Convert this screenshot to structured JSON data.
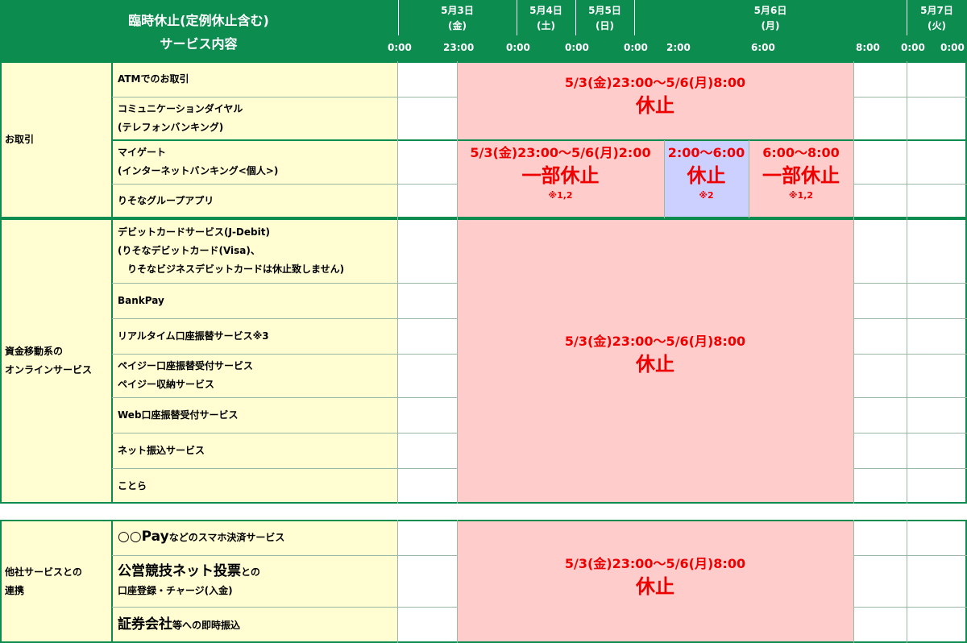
{
  "header": {
    "title_line1": "臨時休止(定例休止含む)",
    "title_line2": "サービス内容",
    "dates": [
      {
        "line1": "5月3日",
        "line2": "(金)"
      },
      {
        "line1": "5月4日",
        "line2": "(土)"
      },
      {
        "line1": "5月5日",
        "line2": "(日)"
      },
      {
        "line1": "5月6日",
        "line2": "(月)"
      },
      {
        "line1": "5月7日",
        "line2": "(火)"
      }
    ],
    "times": [
      "0:00",
      "23:00",
      "0:00",
      "0:00",
      "0:00",
      "2:00",
      "6:00",
      "8:00",
      "0:00",
      "0:00"
    ]
  },
  "section1": {
    "category": "お取引",
    "services": [
      {
        "line1": "ATMでのお取引"
      },
      {
        "line1": "コミュニケーションダイヤル",
        "line2": "(テレフォンバンキング)"
      },
      {
        "line1": "マイゲート",
        "line2": "(インターネットバンキング<個人>)"
      },
      {
        "line1": "りそなグループアプリ"
      }
    ],
    "outage_a": {
      "period": "5/3(金)23:00～5/6(月)8:00",
      "label": "休止"
    },
    "outage_b1": {
      "period": "5/3(金)23:00～5/6(月)2:00",
      "label": "一部休止",
      "note": "※1,2"
    },
    "outage_b2": {
      "period": "2:00～6:00",
      "label": "休止",
      "note": "※2"
    },
    "outage_b3": {
      "period": "6:00～8:00",
      "label": "一部休止",
      "note": "※1,2"
    }
  },
  "section2": {
    "category_line1": "資金移動系の",
    "category_line2": "オンラインサービス",
    "services": [
      {
        "line1": "デビットカードサービス(J-Debit)",
        "line2": "(りそなデビットカード(Visa)、",
        "line3": "　りそなビジネスデビットカードは休止致しません)"
      },
      {
        "line1": "BankPay"
      },
      {
        "line1": "リアルタイム口座振替サービス※3"
      },
      {
        "line1": "ペイジー口座振替受付サービス",
        "line2": "ペイジー収納サービス"
      },
      {
        "line1": "Web口座振替受付サービス"
      },
      {
        "line1": "ネット振込サービス"
      },
      {
        "line1": "ことら"
      }
    ],
    "outage": {
      "period": "5/3(金)23:00～5/6(月)8:00",
      "label": "休止"
    }
  },
  "section3": {
    "category_line1": "他社サービスとの",
    "category_line2": "連携",
    "services": [
      {
        "big": "○○Pay",
        "rest": "などのスマホ決済サービス"
      },
      {
        "big": "公営競技ネット投票",
        "rest": "との",
        "line2": "口座登録・チャージ(入金)"
      },
      {
        "big": "証券会社",
        "rest": "等への即時振込"
      }
    ],
    "outage": {
      "period": "5/3(金)23:00～5/6(月)8:00",
      "label": "休止"
    }
  }
}
